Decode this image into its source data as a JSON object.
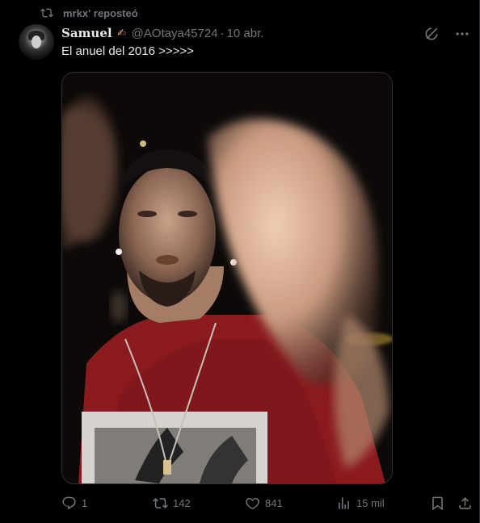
{
  "social_context": {
    "label": "mrkx' reposteó",
    "icon": "repost-icon"
  },
  "author": {
    "name": "Samuel",
    "emoji": "✍",
    "handle": "@AOtaya45724",
    "separator": "·",
    "date": "10 abr."
  },
  "tweet": {
    "text": "El anuel del 2016 >>>>>"
  },
  "top_icons": [
    "grok-icon",
    "more-icon"
  ],
  "actions": {
    "replies": "1",
    "reposts": "142",
    "likes": "841",
    "views": "15 mil"
  },
  "colors": {
    "background": "#000000",
    "text": "#e7e9ea",
    "secondary": "#71767b",
    "border": "#2f3336",
    "shirt": "#8b1a1f"
  }
}
